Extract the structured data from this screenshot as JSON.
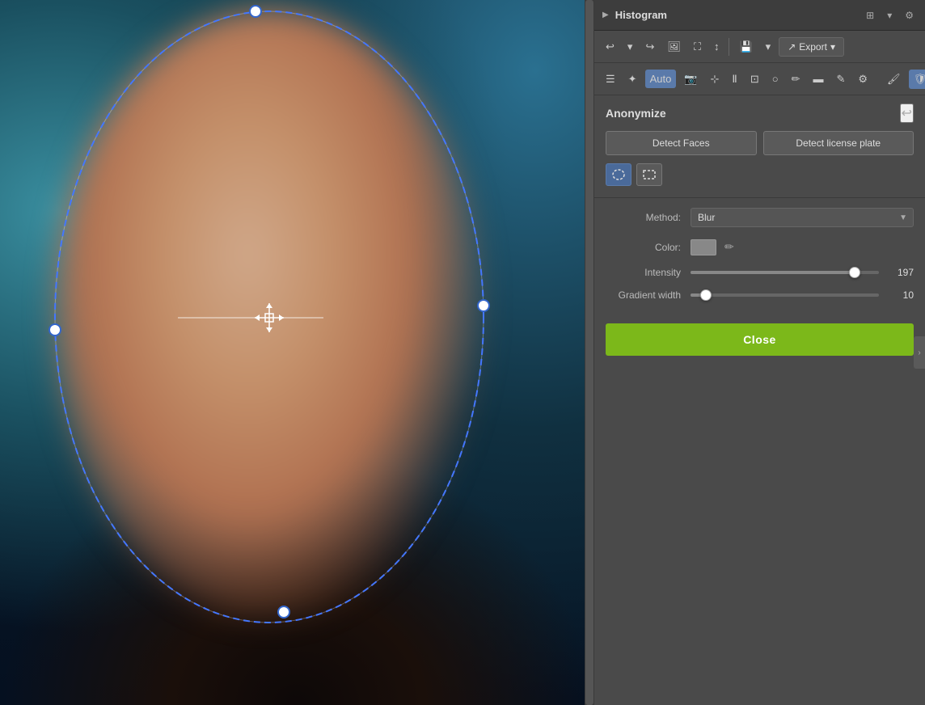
{
  "panel": {
    "histogram_title": "Histogram",
    "toolbar": {
      "undo_label": "↩",
      "redo_label": "↪",
      "image_icon": "🖼",
      "crop_icon": "✂",
      "export_label": "Export",
      "auto_label": "Auto"
    },
    "anonymize": {
      "title": "Anonymize",
      "detect_faces_label": "Detect Faces",
      "detect_plate_label": "Detect license plate",
      "method_label": "Method:",
      "method_value": "Blur",
      "color_label": "Color:",
      "intensity_label": "Intensity",
      "intensity_value": "197",
      "gradient_label": "Gradient width",
      "gradient_value": "10",
      "close_label": "Close"
    }
  },
  "canvas": {
    "alt": "Face image with anonymization ellipse"
  },
  "sliders": {
    "intensity_percent": 87,
    "gradient_percent": 8
  }
}
